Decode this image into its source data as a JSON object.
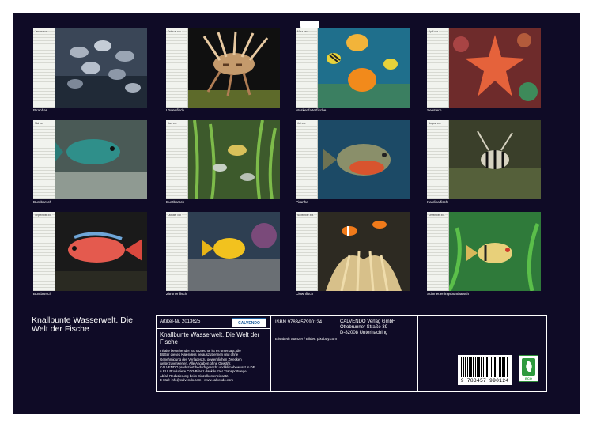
{
  "calendar": {
    "title": "Knallbunte Wasserwelt. Die Welt der Fische",
    "months": [
      {
        "label": "Januar xxx",
        "caption": "Piranhas"
      },
      {
        "label": "Februar xxx",
        "caption": "Löwenfisch"
      },
      {
        "label": "März xxx",
        "caption": "Maskenfalterfische"
      },
      {
        "label": "April xxx",
        "caption": "Seestern"
      },
      {
        "label": "Mai xxx",
        "caption": "Buntbarsch"
      },
      {
        "label": "Juni xxx",
        "caption": "Buntbarsch"
      },
      {
        "label": "Juli xxx",
        "caption": "Piranha"
      },
      {
        "label": "August xxx",
        "caption": "Kardinalfisch"
      },
      {
        "label": "September xxx",
        "caption": "Buntbarsch"
      },
      {
        "label": "Oktober xxx",
        "caption": "Zitronenfisch"
      },
      {
        "label": "November xxx",
        "caption": "Clownfisch"
      },
      {
        "label": "Dezember xxx",
        "caption": "Schmetterlingsbuntbarsch"
      }
    ]
  },
  "info": {
    "article": "Artikel-Nr. 2013625",
    "publisher_badge": "CALVENDO",
    "isbn": "ISBN 9783457990124",
    "product_title": "Knallbunte Wasserwelt. Die Welt der Fische",
    "credits": "Elisabeth Stanzer / Bilder: pixabay.com",
    "publisher_lines": [
      "CALVENDO Verlag GmbH",
      "Ottobrunner Straße 39",
      "D-82008 Unterhaching"
    ],
    "legal_lines": [
      "Inhalte bestehender Schutzrechte ist es untersagt, die",
      "Blätter dieses Kalenders herauszutrennen und ohne",
      "Genehmigung des Verlages zu gewerblichen Zwecken",
      "weiterzuverwerten. Alle Angaben ohne Gewähr.",
      "CALVENDO produziert bedarfsgerecht und klimabewusst in DE",
      "& EU. Produziere CO2-Bilanz dank kurzer Transportwege.",
      "Abfall-Reduzierung beim Einzelkosteneinsatz.",
      "E-Mail: info@calvendo.com · www.calvendo.com"
    ],
    "barcode_digits": "9 783457 990124",
    "eco_label": "ECO"
  },
  "colors": {
    "background": "#0f0b26",
    "text": "#ffffff",
    "accent_blue": "#1b5c9c",
    "eco_green": "#2e9a3e"
  }
}
